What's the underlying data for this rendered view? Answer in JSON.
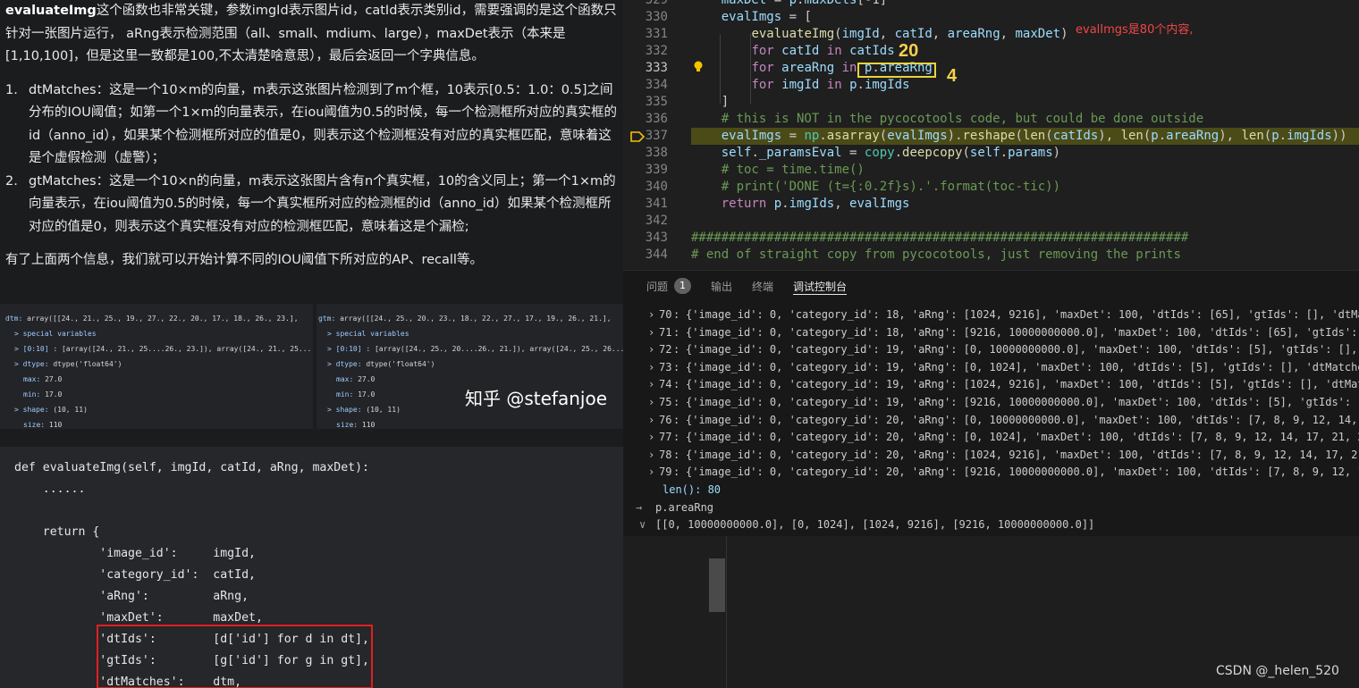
{
  "article": {
    "p1_bold": "evaluateImg",
    "p1_rest": "这个函数也非常关键，参数imgId表示图片id，catId表示类别id，需要强调的是这个函数只针对一张图片运行， aRng表示检测范围（all、small、mdium、large），maxDet表示（本来是[1,10,100]，但是这里一致都是100,不太清楚啥意思），最后会返回一个字典信息。",
    "items": [
      {
        "num": "1.",
        "text": "dtMatches：这是一个10×m的向量，m表示这张图片检测到了m个框，10表示[0.5：1.0：0.5]之间分布的IOU阈值；如第一个1×m的向量表示，在iou阈值为0.5的时候，每一个检测框所对应的真实框的id（anno_id），如果某个检测框所对应的值是0，则表示这个检测框没有对应的真实框匹配，意味着这是个虚假检测（虚警）；"
      },
      {
        "num": "2.",
        "text": "gtMatches：这是一个10×n的向量，m表示这张图片含有n个真实框，10的含义同上；第一个1×m的向量表示，在iou阈值为0.5的时候，每一个真实框所对应的检测框的id（anno_id）如果某个检测框所对应的值是0，则表示这个真实框没有对应的检测框匹配，意味着这是个漏检;"
      }
    ],
    "p2": "有了上面两个信息，我们就可以开始计算不同的IOU阈值下所对应的AP、recall等。",
    "figure": {
      "left": [
        {
          "k": "dtm:",
          "v": " array([[24., 21., 25., 19., 27., 22., 20., 17., 18., 26., 23.],"
        },
        {
          "k": "> special variables",
          "v": ""
        },
        {
          "k": "> [0:10]",
          "v": " : [array([24., 21., 25....26., 23.]), array([24., 21., 25...."
        },
        {
          "k": "> dtype:",
          "v": " dtype('float64')"
        },
        {
          "k": "max:",
          "v": " 27.0"
        },
        {
          "k": "min:",
          "v": " 17.0"
        },
        {
          "k": "> shape:",
          "v": " (10, 11)"
        },
        {
          "k": "size:",
          "v": " 110"
        }
      ],
      "right": [
        {
          "k": "gtm:",
          "v": " array([[24., 25., 20., 23., 18., 22., 27., 17., 19., 26., 21.],"
        },
        {
          "k": "> special variables",
          "v": ""
        },
        {
          "k": "> [0:10]",
          "v": " : [array([24., 25., 20....26., 21.]), array([24., 25., 26...."
        },
        {
          "k": "> dtype:",
          "v": " dtype('float64')"
        },
        {
          "k": "max:",
          "v": " 27.0"
        },
        {
          "k": "min:",
          "v": " 17.0"
        },
        {
          "k": "> shape:",
          "v": " (10, 11)"
        },
        {
          "k": "size:",
          "v": " 110"
        }
      ],
      "watermark": "知乎 @stefanjoe"
    },
    "code": "def evaluateImg(self, imgId, catId, aRng, maxDet):\n    ......\n\n    return {\n            'image_id':     imgId,\n            'category_id':  catId,\n            'aRng':         aRng,\n            'maxDet':       maxDet,\n            'dtIds':        [d['id'] for d in dt],\n            'gtIds':        [g['id'] for g in gt],\n            'dtMatches':    dtm,"
  },
  "editor": {
    "line_numbers": [
      "329",
      "330",
      "331",
      "332",
      "333",
      "334",
      "335",
      "336",
      "337",
      "338",
      "339",
      "340",
      "341",
      "342",
      "343",
      "344"
    ],
    "current_line": "333",
    "annotation": "evalImgs是80个内容,",
    "badge_20": "20",
    "badge_4": "4"
  },
  "panel": {
    "tabs": [
      "问题",
      "输出",
      "终端",
      "调试控制台"
    ],
    "problem_count": "1",
    "active_tab": "调试控制台",
    "rows": [
      {
        "idx": "70",
        "text": "{'image_id': 0, 'category_id': 18, 'aRng': [1024, 9216], 'maxDet': 100, 'dtIds': [65], 'gtIds': [], 'dtMatches"
      },
      {
        "idx": "71",
        "text": "{'image_id': 0, 'category_id': 18, 'aRng': [9216, 10000000000.0], 'maxDet': 100, 'dtIds': [65], 'gtIds': [],"
      },
      {
        "idx": "72",
        "text": "{'image_id': 0, 'category_id': 19, 'aRng': [0, 10000000000.0], 'maxDet': 100, 'dtIds': [5], 'gtIds': [], 'dt"
      },
      {
        "idx": "73",
        "text": "{'image_id': 0, 'category_id': 19, 'aRng': [0, 1024], 'maxDet': 100, 'dtIds': [5], 'gtIds': [], 'dtMatches'"
      },
      {
        "idx": "74",
        "text": "{'image_id': 0, 'category_id': 19, 'aRng': [1024, 9216], 'maxDet': 100, 'dtIds': [5], 'gtIds': [], 'dtMatche"
      },
      {
        "idx": "75",
        "text": "{'image_id': 0, 'category_id': 19, 'aRng': [9216, 10000000000.0], 'maxDet': 100, 'dtIds': [5], 'gtIds': [],"
      },
      {
        "idx": "76",
        "text": "{'image_id': 0, 'category_id': 20, 'aRng': [0, 10000000000.0], 'maxDet': 100, 'dtIds': [7, 8, 9, 12, 14, 17"
      },
      {
        "idx": "77",
        "text": "{'image_id': 0, 'category_id': 20, 'aRng': [0, 1024], 'maxDet': 100, 'dtIds': [7, 8, 9, 12, 14, 17, 21, 24,"
      },
      {
        "idx": "78",
        "text": "{'image_id': 0, 'category_id': 20, 'aRng': [1024, 9216], 'maxDet': 100, 'dtIds': [7, 8, 9, 12, 14, 17, 21,"
      },
      {
        "idx": "79",
        "text": "{'image_id': 0, 'category_id': 20, 'aRng': [9216, 10000000000.0], 'maxDet': 100, 'dtIds': [7, 8, 9, 12, 14,"
      }
    ],
    "len_label": "len(): 80",
    "prompt_symbol": "→",
    "input": "p.areaRng",
    "result_chevron": "∨",
    "result": "[[0, 10000000000.0], [0, 1024], [1024, 9216], [9216, 10000000000.0]]"
  },
  "footer": {
    "csdn": "CSDN @_helen_520",
    "bottom_code_fragment": "..."
  },
  "colors": {
    "accent_red": "#e02020",
    "accent_yellow": "#e8d43c",
    "highlight_line": "#4b4b18"
  }
}
